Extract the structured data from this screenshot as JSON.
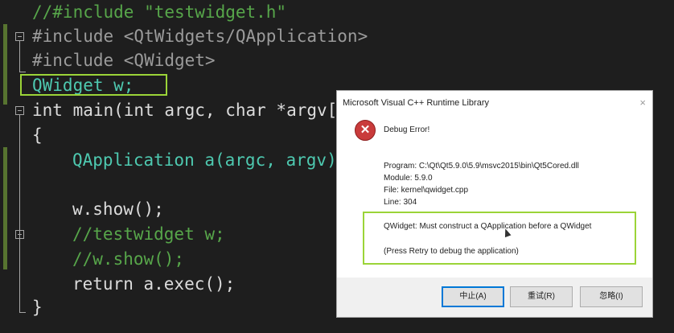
{
  "editor": {
    "lines": [
      "//#include \"testwidget.h\"",
      "#include <QtWidgets/QApplication>",
      "#include <QWidget>",
      "QWidget w;",
      "int main(int argc, char *argv[",
      "{",
      "QApplication a(argc, argv)",
      "w.show();",
      "//testwidget w;",
      "//w.show();",
      "return a.exec();",
      "}"
    ]
  },
  "dialog": {
    "title": "Microsoft Visual C++ Runtime Library",
    "close": "×",
    "icon": "error-icon",
    "error_title": "Debug Error!",
    "program": "Program: C:\\Qt\\Qt5.9.0\\5.9\\msvc2015\\bin\\Qt5Cored.dll",
    "module": "Module: 5.9.0",
    "file": "File: kernel\\qwidget.cpp",
    "line": "Line: 304",
    "message": "QWidget: Must construct a QApplication before a QWidget",
    "hint": "(Press Retry to debug the application)",
    "buttons": {
      "abort": "中止(A)",
      "retry": "重试(R)",
      "ignore": "忽略(I)"
    }
  },
  "colors": {
    "highlight_box": "#9bd438",
    "editor_bg": "#1e1e1e",
    "error_red": "#c93b3b"
  }
}
